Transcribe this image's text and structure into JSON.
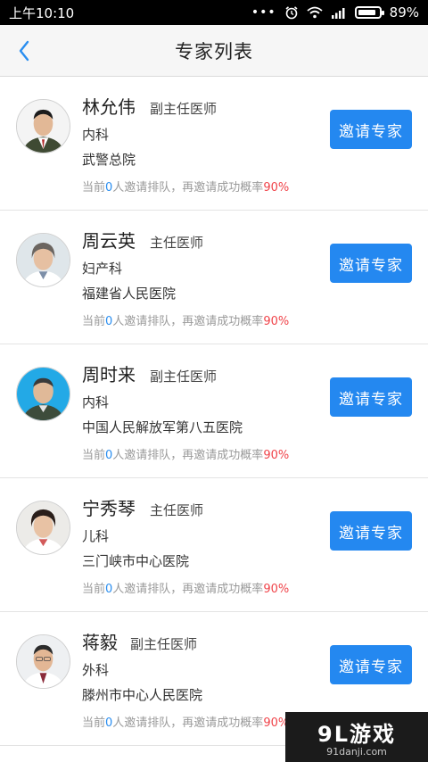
{
  "status_bar": {
    "time": "上午10:10",
    "battery_percent": "89%",
    "icons": [
      "more-dots-icon",
      "alarm-icon",
      "wifi-icon",
      "signal-icon",
      "battery-icon"
    ]
  },
  "header": {
    "title": "专家列表",
    "back_icon": "chevron-left-icon"
  },
  "colors": {
    "accent": "#2488f0",
    "queue_number": "#2a8ef0",
    "success_rate": "#f0444a"
  },
  "experts": [
    {
      "name": "林允伟",
      "title": "副主任医师",
      "department": "内科",
      "hospital": "武警总院",
      "queue_prefix": "当前",
      "queue_count": "0",
      "queue_middle": "人邀请排队，再邀请成功概率",
      "success_rate": "90%",
      "button": "邀请专家"
    },
    {
      "name": "周云英",
      "title": "主任医师",
      "department": "妇产科",
      "hospital": "福建省人民医院",
      "queue_prefix": "当前",
      "queue_count": "0",
      "queue_middle": "人邀请排队，再邀请成功概率",
      "success_rate": "90%",
      "button": "邀请专家"
    },
    {
      "name": "周时来",
      "title": "副主任医师",
      "department": "内科",
      "hospital": "中国人民解放军第八五医院",
      "queue_prefix": "当前",
      "queue_count": "0",
      "queue_middle": "人邀请排队，再邀请成功概率",
      "success_rate": "90%",
      "button": "邀请专家"
    },
    {
      "name": "宁秀琴",
      "title": "主任医师",
      "department": "儿科",
      "hospital": "三门峡市中心医院",
      "queue_prefix": "当前",
      "queue_count": "0",
      "queue_middle": "人邀请排队，再邀请成功概率",
      "success_rate": "90%",
      "button": "邀请专家"
    },
    {
      "name": "蒋毅",
      "title": "副主任医师",
      "department": "外科",
      "hospital": "滕州市中心人民医院",
      "queue_prefix": "当前",
      "queue_count": "0",
      "queue_middle": "人邀请排队，再邀请成功概率",
      "success_rate": "90%",
      "button": "邀请专家"
    }
  ],
  "watermark": {
    "brand": "9L游戏",
    "domain": "91danji.com"
  }
}
